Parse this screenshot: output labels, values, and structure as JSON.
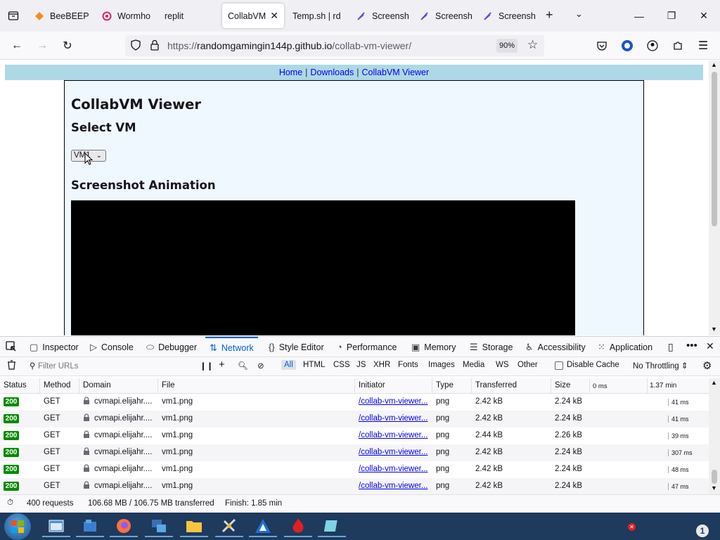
{
  "browser": {
    "tabs": [
      {
        "label": "BeeBEEP",
        "color": "#f28c28"
      },
      {
        "label": "Wormho",
        "color": "#e0245e"
      },
      {
        "label": "replit",
        "color": "#f26207"
      },
      {
        "label": "CollabVM",
        "active": true
      },
      {
        "label": "Temp.sh | rd",
        "color": "#555555"
      },
      {
        "label": "Screensh",
        "color": "#7542e5"
      },
      {
        "label": "Screensh",
        "color": "#7542e5"
      },
      {
        "label": "Screensh",
        "color": "#7542e5"
      }
    ],
    "url_prefix": "https://",
    "url_host": "randomgamingin144p.github.io",
    "url_path": "/collab-vm-viewer/",
    "zoom": "90%"
  },
  "page": {
    "nav": {
      "home": "Home",
      "downloads": "Downloads",
      "viewer": "CollabVM Viewer",
      "sep": "|"
    },
    "title": "CollabVM Viewer",
    "select_heading": "Select VM",
    "select_value": "VM1",
    "anim_heading": "Screenshot Animation"
  },
  "devtools": {
    "tabs": [
      "Inspector",
      "Console",
      "Debugger",
      "Network",
      "Style Editor",
      "Performance",
      "Memory",
      "Storage",
      "Accessibility",
      "Application"
    ],
    "active_tab": "Network",
    "filter_placeholder": "Filter URLs",
    "filters": [
      "All",
      "HTML",
      "CSS",
      "JS",
      "XHR",
      "Fonts",
      "Images",
      "Media",
      "WS",
      "Other"
    ],
    "disable_cache": "Disable Cache",
    "throttling": "No Throttling",
    "columns": [
      "Status",
      "Method",
      "Domain",
      "File",
      "Initiator",
      "Type",
      "Transferred",
      "Size",
      "0 ms",
      "1.37 min"
    ],
    "rows": [
      {
        "status": "200",
        "method": "GET",
        "domain": "cvmapi.elijahr....",
        "file": "vm1.png",
        "initiator": "/collab-vm-viewer...",
        "type": "png",
        "transferred": "2.42 kB",
        "size": "2.24 kB",
        "time": "41 ms"
      },
      {
        "status": "200",
        "method": "GET",
        "domain": "cvmapi.elijahr....",
        "file": "vm1.png",
        "initiator": "/collab-vm-viewer...",
        "type": "png",
        "transferred": "2.42 kB",
        "size": "2.24 kB",
        "time": "41 ms"
      },
      {
        "status": "200",
        "method": "GET",
        "domain": "cvmapi.elijahr....",
        "file": "vm1.png",
        "initiator": "/collab-vm-viewer...",
        "type": "png",
        "transferred": "2.44 kB",
        "size": "2.26 kB",
        "time": "39 ms"
      },
      {
        "status": "200",
        "method": "GET",
        "domain": "cvmapi.elijahr....",
        "file": "vm1.png",
        "initiator": "/collab-vm-viewer...",
        "type": "png",
        "transferred": "2.42 kB",
        "size": "2.24 kB",
        "time": "307 ms"
      },
      {
        "status": "200",
        "method": "GET",
        "domain": "cvmapi.elijahr....",
        "file": "vm1.png",
        "initiator": "/collab-vm-viewer...",
        "type": "png",
        "transferred": "2.42 kB",
        "size": "2.24 kB",
        "time": "48 ms"
      },
      {
        "status": "200",
        "method": "GET",
        "domain": "cvmapi.elijahr....",
        "file": "vm1.png",
        "initiator": "/collab-vm-viewer...",
        "type": "png",
        "transferred": "2.42 kB",
        "size": "2.24 kB",
        "time": "47 ms"
      }
    ],
    "summary": {
      "requests": "400 requests",
      "transferred": "106.68 MB / 106.75 MB transferred",
      "finish": "Finish: 1.85 min"
    }
  },
  "taskbar": {
    "notification_count": "1"
  }
}
